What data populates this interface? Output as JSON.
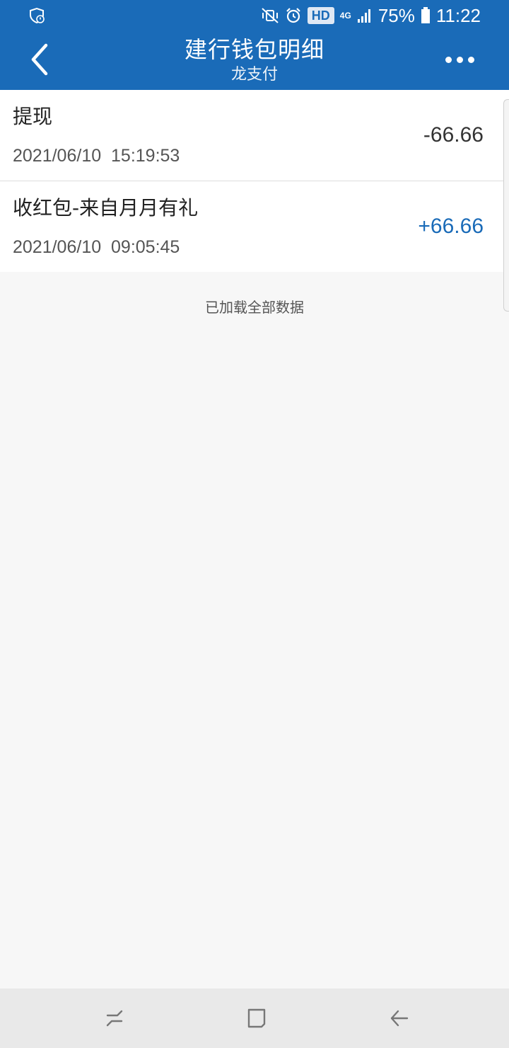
{
  "status_bar": {
    "network": "4G",
    "battery": "75%",
    "time": "11:22",
    "hd_label": "HD",
    "icons": [
      "shield-check-icon",
      "mute-vibrate-icon",
      "alarm-icon",
      "hd-icon",
      "signal-icon",
      "battery-icon"
    ]
  },
  "header": {
    "title": "建行钱包明细",
    "subtitle": "龙支付",
    "background_color": "#1a6bb8"
  },
  "transactions": [
    {
      "title": "提现",
      "time": "2021/06/10  15:19:53",
      "amount": "-66.66",
      "amount_color": "#333333"
    },
    {
      "title": "收红包-来自月月有礼",
      "time": "2021/06/10  09:05:45",
      "amount": "+66.66",
      "amount_color": "#1a6bb8"
    }
  ],
  "footer_note": "已加载全部数据",
  "nav_bar": {
    "icons": [
      "recent-apps-icon",
      "home-icon",
      "back-nav-icon"
    ]
  }
}
